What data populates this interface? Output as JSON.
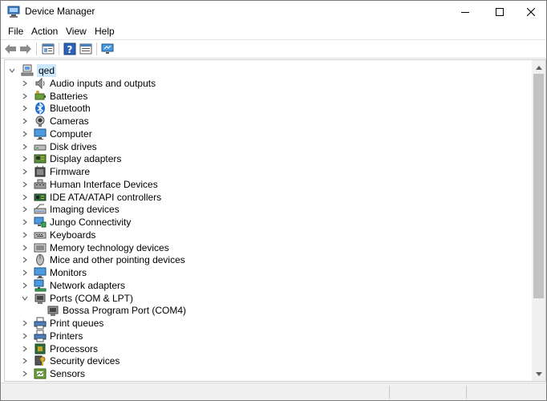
{
  "window": {
    "title": "Device Manager",
    "icon": "device-manager-icon"
  },
  "menu": [
    "File",
    "Action",
    "View",
    "Help"
  ],
  "toolbar": [
    "back-arrow-icon",
    "forward-arrow-icon",
    "properties-sheet-icon",
    "help-icon",
    "details-view-icon",
    "scan-monitor-icon"
  ],
  "tree": {
    "root": {
      "label": "qed",
      "icon": "computer-icon",
      "expanded": true,
      "selected": true
    },
    "categories": [
      {
        "label": "Audio inputs and outputs",
        "icon": "speaker-icon",
        "expanded": false
      },
      {
        "label": "Batteries",
        "icon": "battery-icon",
        "expanded": false
      },
      {
        "label": "Bluetooth",
        "icon": "bluetooth-icon",
        "expanded": false
      },
      {
        "label": "Cameras",
        "icon": "camera-icon",
        "expanded": false
      },
      {
        "label": "Computer",
        "icon": "monitor-icon",
        "expanded": false
      },
      {
        "label": "Disk drives",
        "icon": "disk-drive-icon",
        "expanded": false
      },
      {
        "label": "Display adapters",
        "icon": "display-adapter-icon",
        "expanded": false
      },
      {
        "label": "Firmware",
        "icon": "firmware-icon",
        "expanded": false
      },
      {
        "label": "Human Interface Devices",
        "icon": "hid-icon",
        "expanded": false
      },
      {
        "label": "IDE ATA/ATAPI controllers",
        "icon": "controller-icon",
        "expanded": false
      },
      {
        "label": "Imaging devices",
        "icon": "scanner-icon",
        "expanded": false
      },
      {
        "label": "Jungo Connectivity",
        "icon": "network-monitor-icon",
        "expanded": false
      },
      {
        "label": "Keyboards",
        "icon": "keyboard-icon",
        "expanded": false
      },
      {
        "label": "Memory technology devices",
        "icon": "memory-icon",
        "expanded": false
      },
      {
        "label": "Mice and other pointing devices",
        "icon": "mouse-icon",
        "expanded": false
      },
      {
        "label": "Monitors",
        "icon": "monitor-icon",
        "expanded": false
      },
      {
        "label": "Network adapters",
        "icon": "network-adapter-icon",
        "expanded": false
      },
      {
        "label": "Ports (COM & LPT)",
        "icon": "port-icon",
        "expanded": true,
        "children": [
          {
            "label": "Bossa Program Port (COM4)",
            "icon": "port-icon"
          }
        ]
      },
      {
        "label": "Print queues",
        "icon": "printer-icon",
        "expanded": false
      },
      {
        "label": "Printers",
        "icon": "printer-icon",
        "expanded": false
      },
      {
        "label": "Processors",
        "icon": "processor-icon",
        "expanded": false
      },
      {
        "label": "Security devices",
        "icon": "security-key-icon",
        "expanded": false
      },
      {
        "label": "Sensors",
        "icon": "sensor-icon",
        "expanded": false
      }
    ]
  },
  "colors": {
    "selection": "#cce8ff",
    "accent": "#0078d7",
    "scroll_thumb": "#c2c2c2"
  }
}
